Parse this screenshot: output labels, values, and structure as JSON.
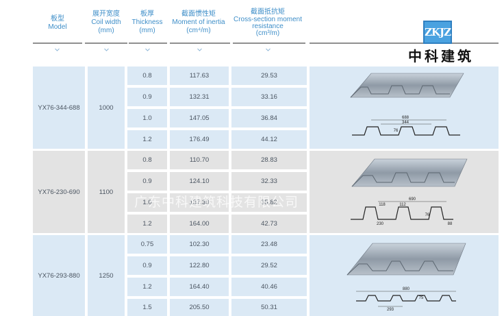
{
  "headers": {
    "model": {
      "cn": "板型",
      "en": "Model"
    },
    "coil": {
      "cn": "展开宽度",
      "en1": "Coil width",
      "en2": "(mm)"
    },
    "thickness": {
      "cn": "板厚",
      "en1": "Thickness",
      "en2": "(mm)"
    },
    "inertia": {
      "cn": "截面惯性矩",
      "en1": "Moment of inertia",
      "en2": "(cm⁴/m)"
    },
    "resistance": {
      "cn": "截面抵抗矩",
      "en1": "Cross-section moment",
      "en2": "resistance",
      "en3": "(cm³/m)"
    }
  },
  "logo": {
    "mark": "ZKJZ",
    "name": "中科建筑"
  },
  "watermark": "广东中科建筑科技有限公司",
  "products": [
    {
      "model": "YX76-344-688",
      "coil": "1000",
      "rows": [
        {
          "t": "0.8",
          "i": "117.63",
          "r": "29.53"
        },
        {
          "t": "0.9",
          "i": "132.31",
          "r": "33.16"
        },
        {
          "t": "1.0",
          "i": "147.05",
          "r": "36.84"
        },
        {
          "t": "1.2",
          "i": "176.49",
          "r": "44.12"
        }
      ],
      "dims": [
        "688",
        "344",
        "76"
      ]
    },
    {
      "model": "YX76-230-690",
      "coil": "1100",
      "rows": [
        {
          "t": "0.8",
          "i": "110.70",
          "r": "28.83"
        },
        {
          "t": "0.9",
          "i": "124.10",
          "r": "32.33"
        },
        {
          "t": "1.0",
          "i": "137.30",
          "r": "35.82"
        },
        {
          "t": "1.2",
          "i": "164.00",
          "r": "42.73"
        }
      ],
      "dims": [
        "690",
        "118",
        "112",
        "76",
        "230",
        "88"
      ]
    },
    {
      "model": "YX76-293-880",
      "coil": "1250",
      "rows": [
        {
          "t": "0.75",
          "i": "102.30",
          "r": "23.48"
        },
        {
          "t": "0.9",
          "i": "122.80",
          "r": "29.52"
        },
        {
          "t": "1.2",
          "i": "164.40",
          "r": "40.46"
        },
        {
          "t": "1.5",
          "i": "205.50",
          "r": "50.31"
        }
      ],
      "dims": [
        "880",
        "75",
        "293"
      ]
    }
  ]
}
